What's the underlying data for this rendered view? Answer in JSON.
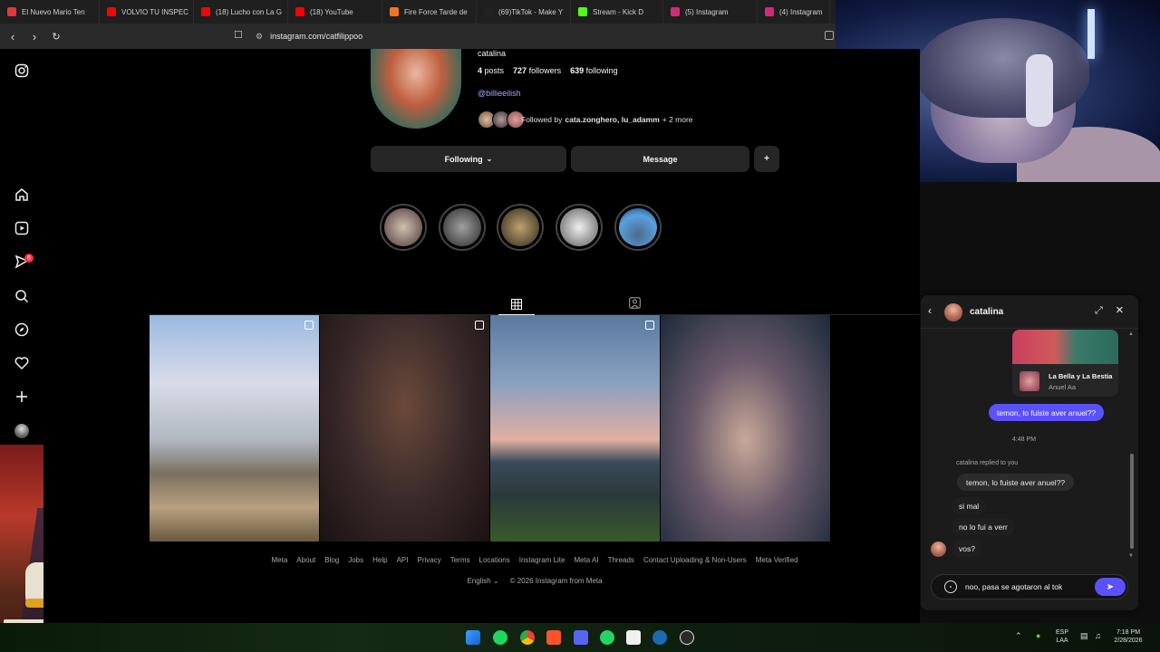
{
  "browser": {
    "tabs": [
      {
        "label": "El Nuevo Mario Ten",
        "color": "#e03a3a"
      },
      {
        "label": "VOLVIO TU INSPEC",
        "color": "#ff0000"
      },
      {
        "label": "(18) Lucho con La G",
        "color": "#ff0000"
      },
      {
        "label": "(18) YouTube",
        "color": "#ff0000"
      },
      {
        "label": "Fire Force Tarde de",
        "color": "#f47521"
      },
      {
        "label": "(69)TikTok - Make Y",
        "color": "#111111"
      },
      {
        "label": "Stream - Kick D",
        "color": "#53fc18"
      },
      {
        "label": "(5) Instagram",
        "color": "#d62976"
      },
      {
        "label": "(4) Instagram",
        "color": "#d62976"
      }
    ],
    "url": "instagram.com/catfilippoo"
  },
  "sidebar": {
    "icons": [
      "instagram-logo-icon",
      "home-icon",
      "reels-icon",
      "messages-icon",
      "search-icon",
      "explore-icon",
      "notifications-icon",
      "create-icon",
      "profile-icon"
    ],
    "badge": "6"
  },
  "profile": {
    "username": "catalina",
    "posts": "4",
    "posts_label": "posts",
    "followers": "727",
    "followers_label": "followers",
    "following": "639",
    "following_label": "following",
    "link": "@billieeilish",
    "followed_by_prefix": "Followed by",
    "followed_by_names": "cata.zonghero, lu_adamm",
    "followed_by_more": "+ 2 more",
    "following_btn": "Following",
    "message_btn": "Message"
  },
  "footer": {
    "links": [
      "Meta",
      "About",
      "Blog",
      "Jobs",
      "Help",
      "API",
      "Privacy",
      "Terms",
      "Locations",
      "Instagram Lite",
      "Meta AI",
      "Threads",
      "Contact Uploading & Non-Users",
      "Meta Verified"
    ],
    "language": "English",
    "copyright": "© 2026 Instagram from Meta"
  },
  "chat": {
    "name": "catalina",
    "shared_title": "La Bella y La Bestia",
    "shared_artist": "Anuel Aa",
    "my_message": "temon, lo fuiste aver anuel??",
    "time": "4:48 PM",
    "replied_label": "catalina replied to you",
    "quoted": "temon, lo fuiste aver anuel??",
    "msg1": "si mal",
    "msg2": "no lo fui a verr",
    "msg3": "vos?",
    "compose_text": "noo, pasa se agotaron al tok"
  },
  "taskbar": {
    "lang_top": "ESP",
    "lang_bottom": "LAA",
    "time": "7:18 PM",
    "date": "2/28/2026"
  }
}
